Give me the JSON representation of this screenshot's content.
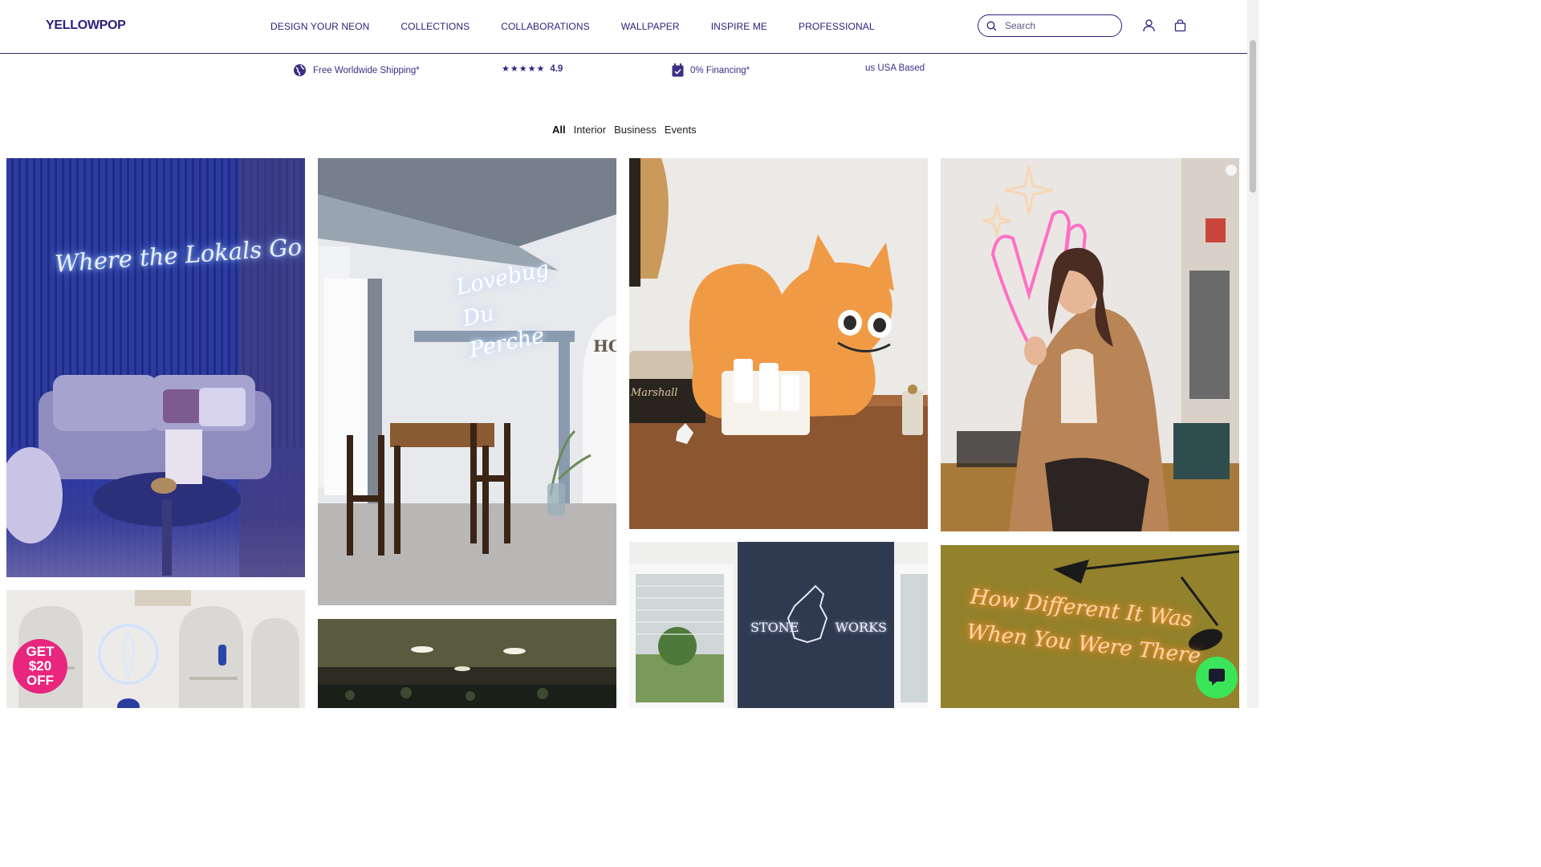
{
  "header": {
    "logo": "YELLOWPOP",
    "nav": [
      "DESIGN YOUR NEON",
      "COLLECTIONS",
      "COLLABORATIONS",
      "WALLPAPER",
      "INSPIRE ME",
      "PROFESSIONAL"
    ],
    "search_placeholder": "Search"
  },
  "perks": {
    "shipping": "Free Worldwide Shipping*",
    "stars": "★★★★★",
    "rating": "4.9",
    "financing": "0% Financing*",
    "usa": "us USA Based"
  },
  "tabs": [
    "All",
    "Interior",
    "Business",
    "Events"
  ],
  "gallery": {
    "tile1_sign": "Where the Lokals Go",
    "tile2_sign": "Lovebug Du Perche",
    "tile2_wall": "HOY",
    "tile3_brand": "Marshall",
    "tile6_sign": "STONE WORKS",
    "tile8_sign": "How Different It Was When You Were There"
  },
  "promo": {
    "line1": "GET",
    "line2": "$20",
    "line3": "OFF"
  },
  "colors": {
    "brand": "#2d1e7a",
    "promo": "#e8267d",
    "chat": "#3be55a"
  }
}
